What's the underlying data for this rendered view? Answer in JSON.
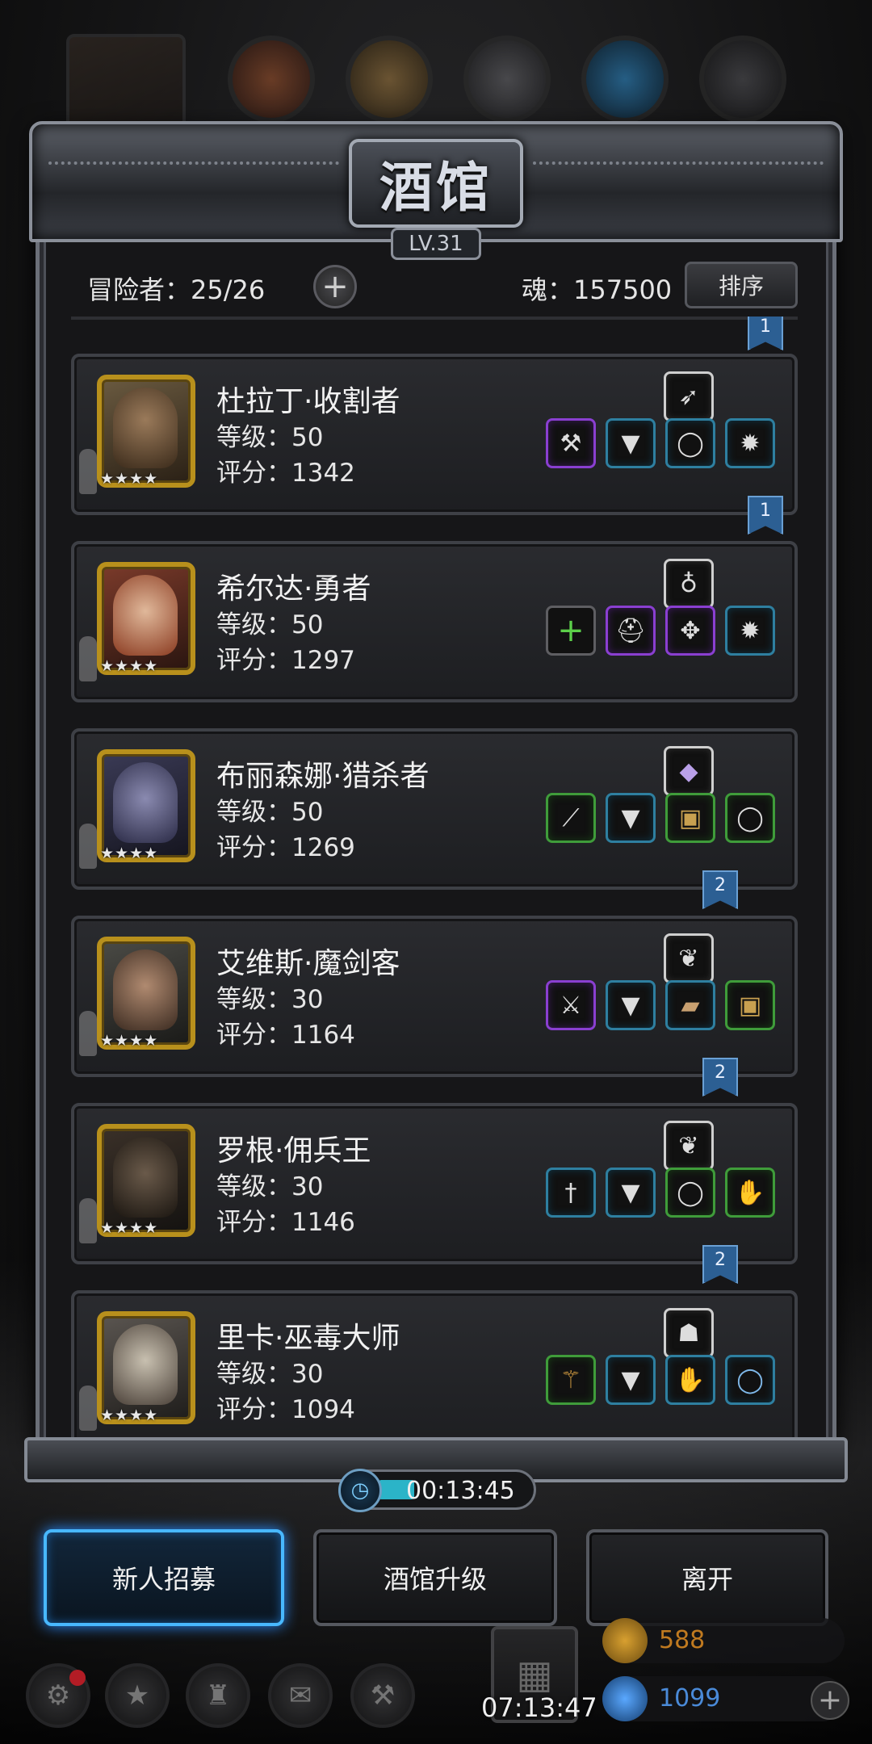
{
  "panel": {
    "title": "酒馆",
    "level": "LV.31"
  },
  "header": {
    "adventurers": "冒险者：25/26",
    "soul": "魂：157500",
    "sort_label": "排序"
  },
  "heroes": [
    {
      "name": "杜拉丁·收割者",
      "level": "等级：50",
      "score": "评分：1342",
      "stars": "★★★★",
      "rank_flag": "1",
      "top_item": "quiver-icon",
      "items": [
        {
          "icon": "axe-icon",
          "rarity": "purple"
        },
        {
          "icon": "armor-icon",
          "rarity": "blue"
        },
        {
          "icon": "ring-icon",
          "rarity": "blue"
        },
        {
          "icon": "amulet-icon",
          "rarity": "blue"
        }
      ]
    },
    {
      "name": "希尔达·勇者",
      "level": "等级：50",
      "score": "评分：1297",
      "stars": "★★★★",
      "rank_flag": "1",
      "top_item": "necklace-icon",
      "items": [
        {
          "icon": "add-slot-icon",
          "rarity": "gray"
        },
        {
          "icon": "helmet-icon",
          "rarity": "purple"
        },
        {
          "icon": "charm-icon",
          "rarity": "purple"
        },
        {
          "icon": "amulet-icon",
          "rarity": "blue"
        }
      ]
    },
    {
      "name": "布丽森娜·猎杀者",
      "level": "等级：50",
      "score": "评分：1269",
      "stars": "★★★★",
      "rank_flag": "",
      "top_item": "crystal-icon",
      "items": [
        {
          "icon": "blade-icon",
          "rarity": "green"
        },
        {
          "icon": "armor-icon",
          "rarity": "blue"
        },
        {
          "icon": "chest-armor-icon",
          "rarity": "green"
        },
        {
          "icon": "ring-icon",
          "rarity": "green"
        }
      ]
    },
    {
      "name": "艾维斯·魔剑客",
      "level": "等级：30",
      "score": "评分：1164",
      "stars": "★★★★",
      "rank_flag": "2",
      "top_item": "feather-icon",
      "items": [
        {
          "icon": "sword-icon",
          "rarity": "purple"
        },
        {
          "icon": "armor-icon",
          "rarity": "blue"
        },
        {
          "icon": "bracer-icon",
          "rarity": "blue"
        },
        {
          "icon": "chest-armor-icon",
          "rarity": "green"
        }
      ]
    },
    {
      "name": "罗根·佣兵王",
      "level": "等级：30",
      "score": "评分：1146",
      "stars": "★★★★",
      "rank_flag": "2",
      "top_item": "feather-icon",
      "items": [
        {
          "icon": "dagger-icon",
          "rarity": "blue"
        },
        {
          "icon": "armor-icon",
          "rarity": "blue"
        },
        {
          "icon": "ring-icon",
          "rarity": "green"
        },
        {
          "icon": "gauntlet-icon",
          "rarity": "green"
        }
      ]
    },
    {
      "name": "里卡·巫毒大师",
      "level": "等级：30",
      "score": "评分：1094",
      "stars": "★★★★",
      "rank_flag": "2",
      "top_item": "cloak-icon",
      "items": [
        {
          "icon": "staff-icon",
          "rarity": "green"
        },
        {
          "icon": "armor-icon",
          "rarity": "blue"
        },
        {
          "icon": "gauntlet-icon",
          "rarity": "blue"
        },
        {
          "icon": "ring-icon",
          "rarity": "blue"
        }
      ]
    }
  ],
  "timer": "00:13:45",
  "buttons": {
    "recruit": "新人招募",
    "upgrade": "酒馆升级",
    "leave": "离开"
  },
  "clock": "07:13:47",
  "currency": {
    "gold": "588",
    "gems": "1099"
  },
  "colors": {
    "gold_frame": "#b8901c",
    "rarity_purple": "#8a3fd1",
    "rarity_blue": "#2e7fa0",
    "rarity_green": "#3f9c3a",
    "active_button_glow": "#48b8ff",
    "rank_flag": "#2c5f93"
  }
}
